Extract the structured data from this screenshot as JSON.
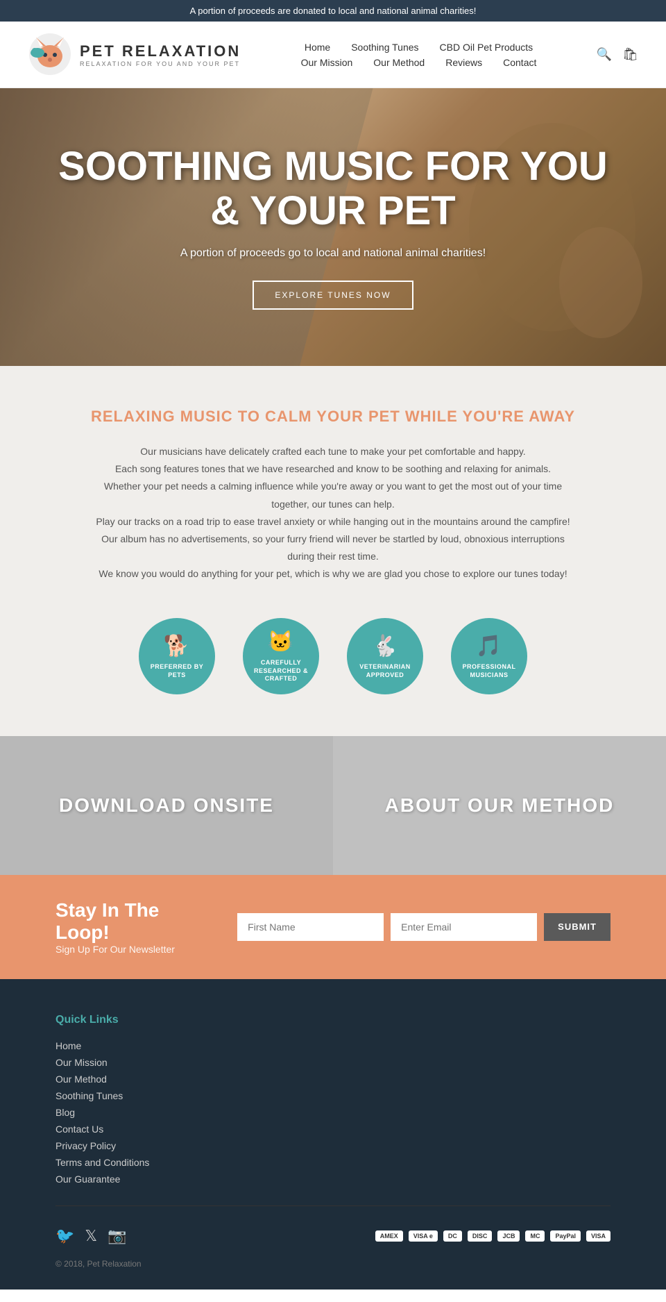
{
  "topBanner": {
    "text": "A portion of proceeds are donated to local and national animal charities!"
  },
  "header": {
    "logoTitle": "Pet RelaXation",
    "logoSubtitle": "Relaxation For You And Your Pet",
    "nav": {
      "row1": [
        {
          "label": "Home",
          "id": "home"
        },
        {
          "label": "Soothing Tunes",
          "id": "soothing-tunes"
        },
        {
          "label": "CBD Oil Pet Products",
          "id": "cbd-oil"
        }
      ],
      "row2": [
        {
          "label": "Our Mission",
          "id": "our-mission"
        },
        {
          "label": "Our Method",
          "id": "our-method"
        },
        {
          "label": "Reviews",
          "id": "reviews"
        },
        {
          "label": "Contact",
          "id": "contact"
        }
      ]
    }
  },
  "hero": {
    "title": "SOOTHING MUSIC FOR YOU & YOUR PET",
    "subtitle": "A portion of proceeds go to local and national animal charities!",
    "buttonLabel": "EXPLORE TUNES NOW"
  },
  "relaxSection": {
    "title": "RELAXING MUSIC TO CALM YOUR PET WHILE YOU'RE AWAY",
    "paragraphs": [
      "Our musicians have delicately crafted each tune to make your pet comfortable and happy.",
      "Each song features tones that we have researched and know to be soothing and relaxing for animals.",
      "Whether your pet needs a calming influence while you're away or you want to get the most out of your time together, our tunes can help.",
      "Play our tracks on a road trip to ease travel anxiety or while hanging out in the mountains around the campfire!",
      "Our album has no advertisements, so your furry friend will never be startled by loud, obnoxious interruptions during their rest time.",
      "We know you would do anything for your pet, which is why we are glad you chose to explore our tunes today!"
    ]
  },
  "badges": [
    {
      "icon": "🐕",
      "label": "PREFERRED BY PETS"
    },
    {
      "icon": "🐱",
      "label": "CAREFULLY RESEARCHED & CRAFTED"
    },
    {
      "icon": "🐇",
      "label": "VETERINARIAN APPROVED"
    },
    {
      "icon": "🎵",
      "label": "PROFESSIONAL MUSICIANS"
    }
  ],
  "splitSection": {
    "leftTitle": "DOWNLOAD ONSITE",
    "rightTitle": "ABOUT OUR METHOD"
  },
  "newsletter": {
    "title": "Stay In The Loop!",
    "subtitle": "Sign Up For Our Newsletter",
    "firstNamePlaceholder": "First Name",
    "emailPlaceholder": "Enter Email",
    "buttonLabel": "SUBMIT"
  },
  "footer": {
    "quickLinksTitle": "Quick Links",
    "links": [
      {
        "label": "Home"
      },
      {
        "label": "Our Mission"
      },
      {
        "label": "Our Method"
      },
      {
        "label": "Soothing Tunes"
      },
      {
        "label": "Blog"
      },
      {
        "label": "Contact Us"
      },
      {
        "label": "Privacy Policy"
      },
      {
        "label": "Terms and Conditions"
      },
      {
        "label": "Our Guarantee"
      }
    ],
    "paymentBadges": [
      "VISA",
      "MC",
      "DISC",
      "AMEX",
      "JCB",
      "PayPal"
    ],
    "copyright": "© 2018, Pet Relaxation"
  }
}
